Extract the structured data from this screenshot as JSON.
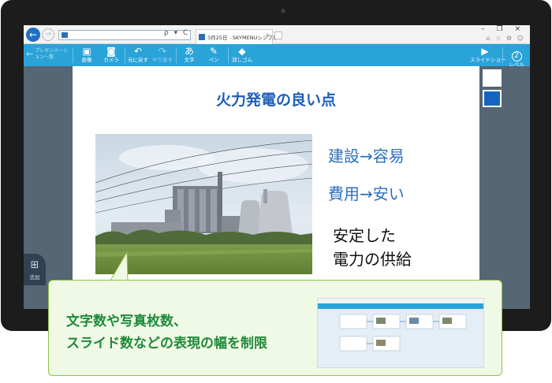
{
  "browser": {
    "back_glyph": "←",
    "forward_glyph": "→",
    "address_icons": "ρ ▾ C",
    "tab_title": "3月25日 - SKYMENUシンプル...",
    "tab_close": "×",
    "window_controls": "–  ❐  ×",
    "right_icons": "⌂ ☆ ⚙ ☺"
  },
  "toolbar": {
    "back_label": "プレゼンテーション一覧",
    "buttons": [
      {
        "label": "画像",
        "icon": "image-icon",
        "glyph": "▣",
        "enabled": true
      },
      {
        "label": "カメラ",
        "icon": "camera-icon",
        "glyph": "◙",
        "enabled": true
      },
      {
        "label": "元に戻す",
        "icon": "undo-icon",
        "glyph": "↶",
        "enabled": true
      },
      {
        "label": "やり直す",
        "icon": "redo-icon",
        "glyph": "↷",
        "enabled": false
      },
      {
        "label": "文字",
        "icon": "text-icon",
        "glyph": "あ",
        "enabled": true
      },
      {
        "label": "ペン",
        "icon": "pen-icon",
        "glyph": "✎",
        "enabled": true
      },
      {
        "label": "消しゴム",
        "icon": "eraser-icon",
        "glyph": "◆",
        "enabled": true
      }
    ],
    "slideshow_label": "スライドショー",
    "slideshow_glyph": "▶",
    "level_label": "レベル",
    "level_value": "2"
  },
  "slide": {
    "title": "火力発電の良い点",
    "bullets": [
      "建設→容易",
      "費用→安い"
    ],
    "dark_lines": [
      "安定した",
      "電力の供給"
    ]
  },
  "side_colors": [
    "#ffffff",
    "#1565c0"
  ],
  "add_button": {
    "label": "追加",
    "glyph": "⊞"
  },
  "callout": {
    "line1": "文字数や写真枚数、",
    "line2": "スライド数などの表現の幅を制限"
  },
  "colors": {
    "accent": "#2aa3d9",
    "title_blue": "#1e5fb8",
    "caption_green": "#1f8a3a",
    "callout_border": "#8cc63f"
  }
}
